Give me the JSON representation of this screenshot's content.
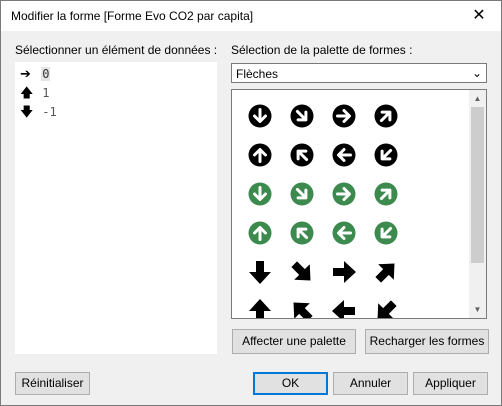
{
  "window": {
    "title": "Modifier la forme [Forme Evo CO2 par capita]",
    "close_glyph": "✕"
  },
  "left": {
    "label": "Sélectionner un élément de données :",
    "items": [
      {
        "arrow": "➔",
        "value": "0",
        "selected": true
      },
      {
        "arrow": "🡅",
        "value": "1",
        "selected": false
      },
      {
        "arrow": "🡇",
        "value": "-1",
        "selected": false
      }
    ]
  },
  "right": {
    "label": "Sélection de la palette de formes :",
    "palette": "Flèches",
    "shapes": [
      [
        "black-circle-arrow-down",
        "black-circle-arrow-down-right",
        "black-circle-arrow-right",
        "black-circle-arrow-up-right"
      ],
      [
        "black-circle-arrow-up",
        "black-circle-arrow-up-left",
        "black-circle-arrow-left",
        "black-circle-arrow-down-left"
      ],
      [
        "green-circle-arrow-down",
        "green-circle-arrow-down-right",
        "green-circle-arrow-right",
        "green-circle-arrow-up-right"
      ],
      [
        "green-circle-arrow-up",
        "green-circle-arrow-up-left",
        "green-circle-arrow-left",
        "green-circle-arrow-down-left"
      ],
      [
        "black-arrow-down",
        "black-arrow-down-right",
        "black-arrow-right",
        "black-arrow-up-right"
      ],
      [
        "black-arrow-up",
        "black-arrow-up-left",
        "black-arrow-left",
        "black-arrow-down-left"
      ]
    ],
    "colors": {
      "black": "#000000",
      "green": "#3c8a4e"
    }
  },
  "buttons": {
    "assign_palette": "Affecter une palette",
    "reload_shapes": "Recharger les formes",
    "reset": "Réinitialiser",
    "ok": "OK",
    "cancel": "Annuler",
    "apply": "Appliquer"
  }
}
